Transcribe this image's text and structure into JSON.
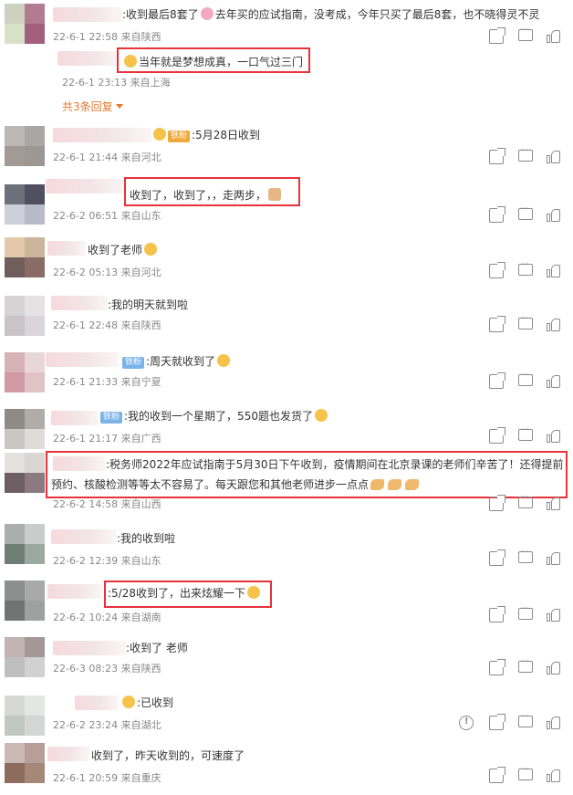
{
  "comments": [
    {
      "text": ":收到最后8套了",
      "text2": "去年买的应试指南，没考成，今年只买了最后8套，也不晓得灵不灵",
      "meta": "22-6-1 22:58 来自陕西",
      "replies_label": "共3条回复",
      "reply": {
        "text": "当年就是梦想成真，一口气过三门",
        "meta": "22-6-1 23:13 来自上海"
      }
    },
    {
      "badge": "铁粉",
      "text": ":5月28日收到",
      "meta": "22-6-1 21:44 来自河北"
    },
    {
      "text": "收到了，收到了，，走两步，",
      "meta": "22-6-2 06:51 来自山东"
    },
    {
      "text": "收到了老师",
      "meta": "22-6-2 05:13 来自河北"
    },
    {
      "text": ":我的明天就到啦",
      "meta": "22-6-1 22:48 来自陕西"
    },
    {
      "badge": "铁粉",
      "text": ":周天就收到了",
      "meta": "22-6-1 21:33 来自宁夏"
    },
    {
      "badge": "铁粉",
      "text": ":我的收到一个星期了，550题也发货了",
      "meta": "22-6-1 21:17 来自广西"
    },
    {
      "text": ":税务师2022年应试指南于5月30日下午收到，疫情期间在北京录课的老师们辛苦了！还得提前",
      "text2": "预约、核酸检测等等太不容易了。每天跟您和其他老师进步一点点",
      "meta": "22-6-2 14:58 来自山西"
    },
    {
      "text": ":我的收到啦",
      "meta": "22-6-2 12:39 来自山东"
    },
    {
      "text": ":5/28收到了，出来炫耀一下",
      "meta": "22-6-2 10:24 来自湖南"
    },
    {
      "text": ":收到了  老师",
      "meta": "22-6-3 08:23 来自陕西"
    },
    {
      "text": ":已收到",
      "meta": "22-6-2 23:24 来自湖北"
    },
    {
      "text": "收到了，昨天收到的，可速度了",
      "meta": "22-6-1 20:59 来自重庆"
    }
  ],
  "icons": [
    "share-icon",
    "comment-icon",
    "like-icon",
    "report-icon"
  ]
}
